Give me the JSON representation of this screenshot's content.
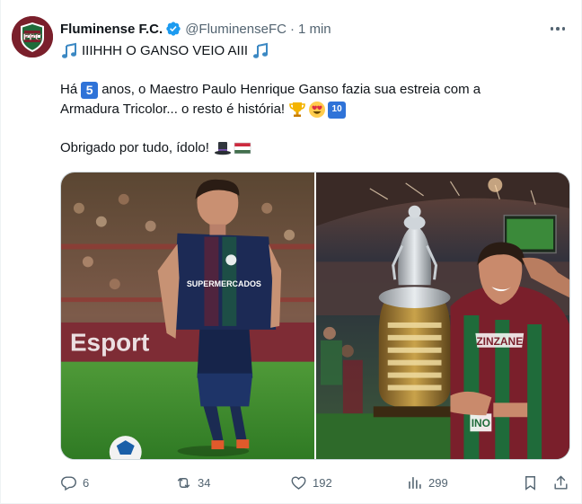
{
  "tweet": {
    "display_name": "Fluminense F.C.",
    "handle": "@FluminenseFC",
    "separator": "·",
    "time": "1 min",
    "line1": "IIIHHH O GANSO VEIO AIII",
    "line2_a": "Há",
    "line2_num": "5",
    "line2_b": "anos, o Maestro Paulo Henrique Ganso fazia sua estreia com a",
    "line3": "Armadura Tricolor... o resto é história!",
    "line3_num": "10",
    "line4": "Obrigado por tudo, ídolo!"
  },
  "actions": {
    "replies": "6",
    "retweets": "34",
    "likes": "192",
    "views": "299"
  },
  "icons": {
    "avatar": "fluminense-crest",
    "verified": "verified-badge-icon",
    "more": "more-options-icon",
    "reply": "reply-icon",
    "retweet": "retweet-icon",
    "like": "heart-icon",
    "views": "views-icon",
    "bookmark": "bookmark-icon",
    "share": "share-icon"
  },
  "colors": {
    "verified": "#1d9bf0",
    "muted": "#536471",
    "text": "#0f1419",
    "club_maroon": "#7a1f2b",
    "club_green": "#1f6b3a"
  }
}
